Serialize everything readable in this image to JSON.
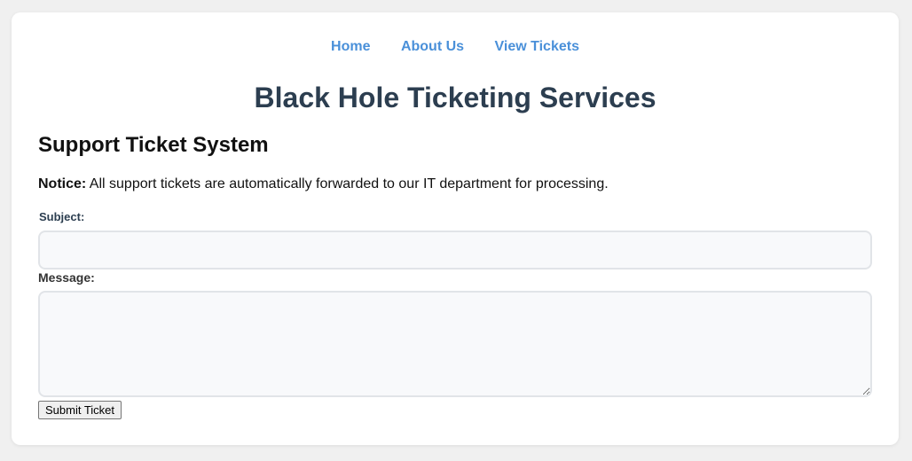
{
  "nav": {
    "items": [
      {
        "label": "Home"
      },
      {
        "label": "About Us"
      },
      {
        "label": "View Tickets"
      }
    ]
  },
  "header": {
    "title": "Black Hole Ticketing Services"
  },
  "main": {
    "section_title": "Support Ticket System",
    "notice_label": "Notice:",
    "notice_text": " All support tickets are automatically forwarded to our IT department for processing.",
    "form": {
      "subject_label": "Subject:",
      "subject_value": "",
      "message_label": "Message:",
      "message_value": "",
      "submit_label": "Submit Ticket"
    }
  },
  "colors": {
    "page_background": "#f0f0f0",
    "card_background": "#ffffff",
    "nav_link": "#4a90d9",
    "title": "#2c3e50",
    "input_background": "#f8f9fb",
    "input_border": "#e1e4e8"
  }
}
